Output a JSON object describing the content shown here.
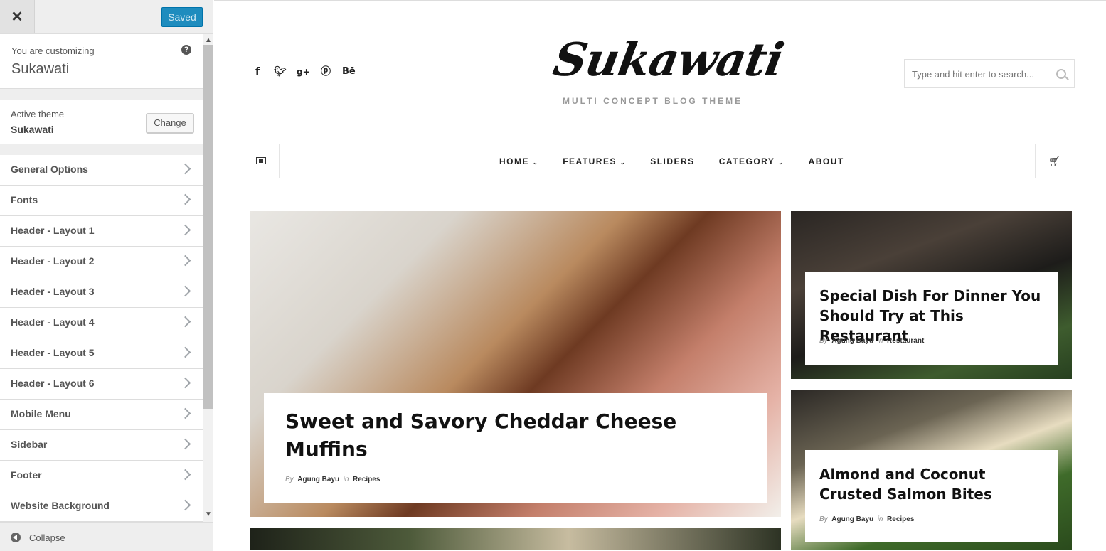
{
  "customizer": {
    "saved_label": "Saved",
    "customizing_label": "You are customizing",
    "customizing_title": "Sukawati",
    "active_theme_label": "Active theme",
    "active_theme_name": "Sukawati",
    "change_label": "Change",
    "menu": [
      {
        "label": "General Options"
      },
      {
        "label": "Fonts"
      },
      {
        "label": "Header - Layout 1"
      },
      {
        "label": "Header - Layout 2"
      },
      {
        "label": "Header - Layout 3"
      },
      {
        "label": "Header - Layout 4"
      },
      {
        "label": "Header - Layout 5"
      },
      {
        "label": "Header - Layout 6"
      },
      {
        "label": "Mobile Menu"
      },
      {
        "label": "Sidebar"
      },
      {
        "label": "Footer"
      },
      {
        "label": "Website Background"
      }
    ],
    "collapse_label": "Collapse",
    "accent_color": "#1e8cbe"
  },
  "site": {
    "logo": "Sukawati",
    "tagline": "MULTI CONCEPT BLOG THEME",
    "search_placeholder": "Type and hit enter to search...",
    "social": [
      "facebook-icon",
      "twitter-icon",
      "google-plus-icon",
      "pinterest-icon",
      "behance-icon"
    ],
    "nav": [
      {
        "label": "HOME",
        "caret": true
      },
      {
        "label": "FEATURES",
        "caret": true
      },
      {
        "label": "SLIDERS",
        "caret": false
      },
      {
        "label": "CATEGORY",
        "caret": true
      },
      {
        "label": "ABOUT",
        "caret": false
      }
    ]
  },
  "posts": {
    "main": {
      "title": "Sweet and Savory Cheddar Cheese Muffins",
      "by": "By",
      "author": "Agung Bayu",
      "in": "in",
      "category": "Recipes"
    },
    "side1": {
      "title": "Special Dish For Dinner You Should Try at This Restaurant",
      "by": "By",
      "author": "Agung Bayu",
      "in": "in",
      "category": "Restaurant"
    },
    "side2": {
      "title": "Almond and Coconut Crusted Salmon Bites",
      "by": "By",
      "author": "Agung Bayu",
      "in": "in",
      "category": "Recipes"
    }
  }
}
